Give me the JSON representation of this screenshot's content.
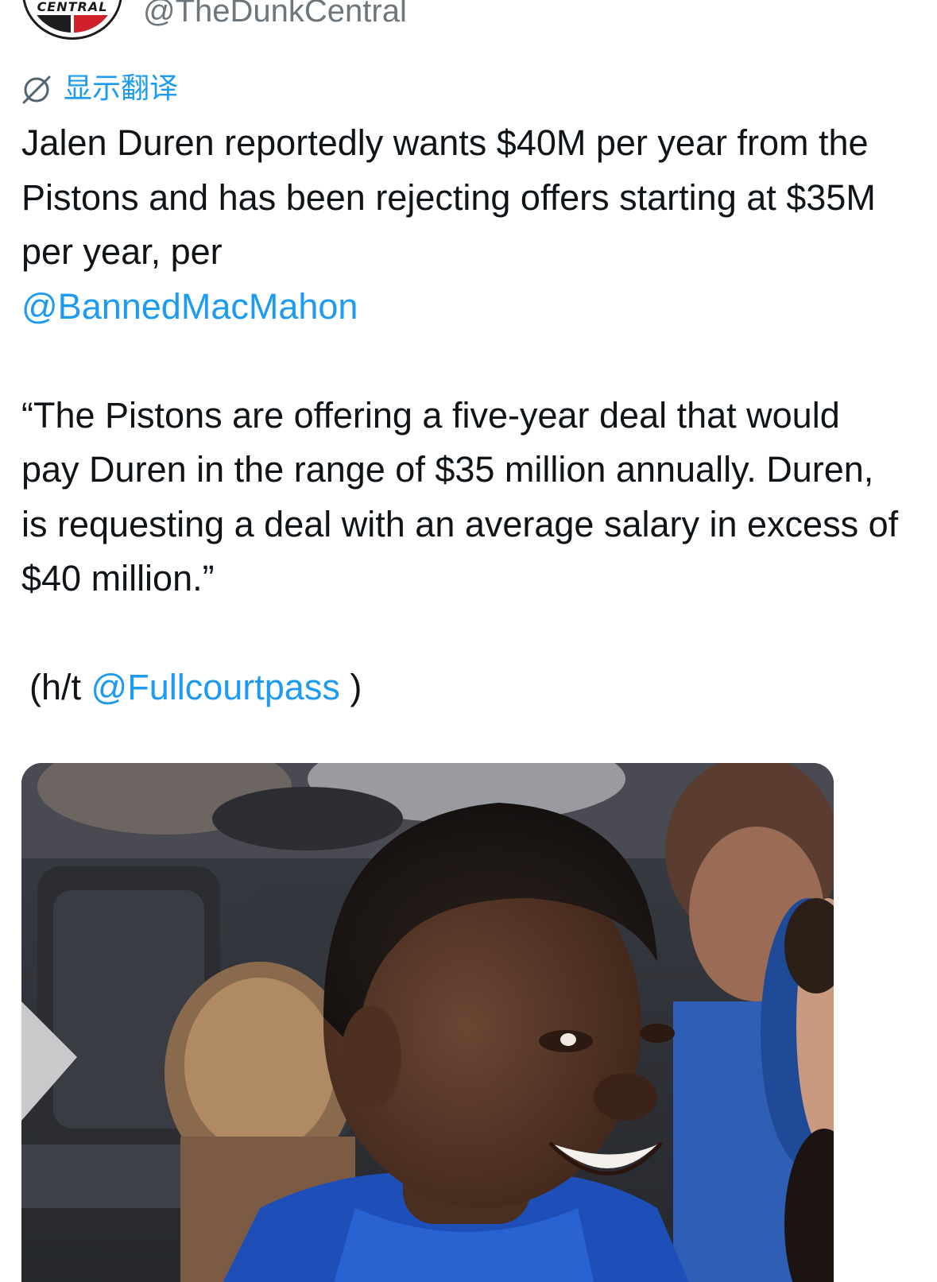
{
  "header": {
    "avatar_text": "CENTRAL",
    "handle": "@TheDunkCentral"
  },
  "translate": {
    "icon": "translate-globe-icon",
    "label": "显示翻译"
  },
  "tweet": {
    "paragraph1_text": "Jalen Duren reportedly wants $40M per year from the Pistons and has been rejecting offers starting at $35M per year, per",
    "paragraph1_mention": "@BannedMacMahon",
    "paragraph2_text": "“The Pistons are offering a five-year deal that would pay Duren in the range of $35 million annually. Duren, is requesting a deal with an average salary in excess of $40 million.”",
    "ht_prefix": "(h/t",
    "ht_mention": "@Fullcourtpass",
    "ht_suffix": ")"
  },
  "media": {
    "kind": "photo"
  },
  "colors": {
    "link": "#1d9bf0",
    "text": "#0f1419",
    "secondary": "#6e767d",
    "jersey_blue": "#1e4fb8"
  }
}
